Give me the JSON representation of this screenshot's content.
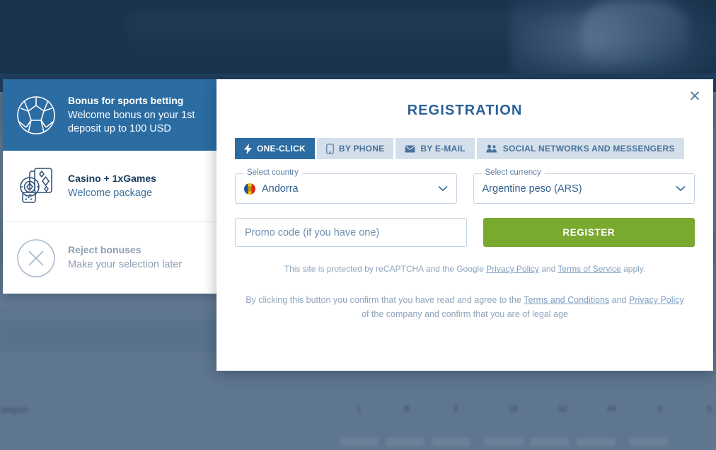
{
  "background": {
    "colors": {
      "banner": "#1c354f",
      "body": "#7f95af",
      "strip": "#264567"
    },
    "blurred_label": "League",
    "blurred_numbers": [
      "1",
      "8",
      "2",
      "18",
      "12",
      "28",
      "0",
      "5"
    ]
  },
  "bonus_panel": {
    "cards": [
      {
        "name": "sports-betting",
        "icon": "soccer-ball-icon",
        "title": "Bonus for sports betting",
        "subtitle": "Welcome bonus on your 1st deposit up to 100 USD",
        "state": "selected"
      },
      {
        "name": "casino-games",
        "icon": "casino-chips-cards-icon",
        "title": "Casino + 1xGames",
        "subtitle": "Welcome package",
        "state": "plain"
      },
      {
        "name": "reject-bonuses",
        "icon": "circle-x-icon",
        "title": "Reject bonuses",
        "subtitle": "Make your selection later",
        "state": "muted"
      }
    ]
  },
  "modal": {
    "title": "REGISTRATION",
    "close_label": "✕",
    "tabs": [
      {
        "label": "ONE-CLICK",
        "icon": "lightning-bolt-icon",
        "active": true
      },
      {
        "label": "BY PHONE",
        "icon": "mobile-phone-icon",
        "active": false
      },
      {
        "label": "BY E-MAIL",
        "icon": "envelope-icon",
        "active": false
      },
      {
        "label": "SOCIAL NETWORKS AND MESSENGERS",
        "icon": "people-group-icon",
        "active": false
      }
    ],
    "country": {
      "legend": "Select country",
      "value": "Andorra",
      "flag": "andorra-flag-icon"
    },
    "currency": {
      "legend": "Select currency",
      "value": "Argentine peso (ARS)"
    },
    "promo": {
      "placeholder": "Promo code (if you have one)",
      "value": ""
    },
    "register_label": "REGISTER",
    "recaptcha": {
      "part1": "This site is protected by reCAPTCHA and the Google ",
      "link1": "Privacy Policy",
      "part2": " and ",
      "link2": "Terms of Service",
      "part3": " apply."
    },
    "terms": {
      "part1": "By clicking this button you confirm that you have read and agree to the ",
      "link1": "Terms and Conditions",
      "part2": " and ",
      "link2": "Privacy Policy",
      "part3": " of the company and confirm that you are of legal age"
    }
  },
  "colors": {
    "accent_blue": "#2b6ca3",
    "title_blue": "#2c6099",
    "register_green": "#79a92e",
    "tab_inactive": "#d3dfea"
  }
}
